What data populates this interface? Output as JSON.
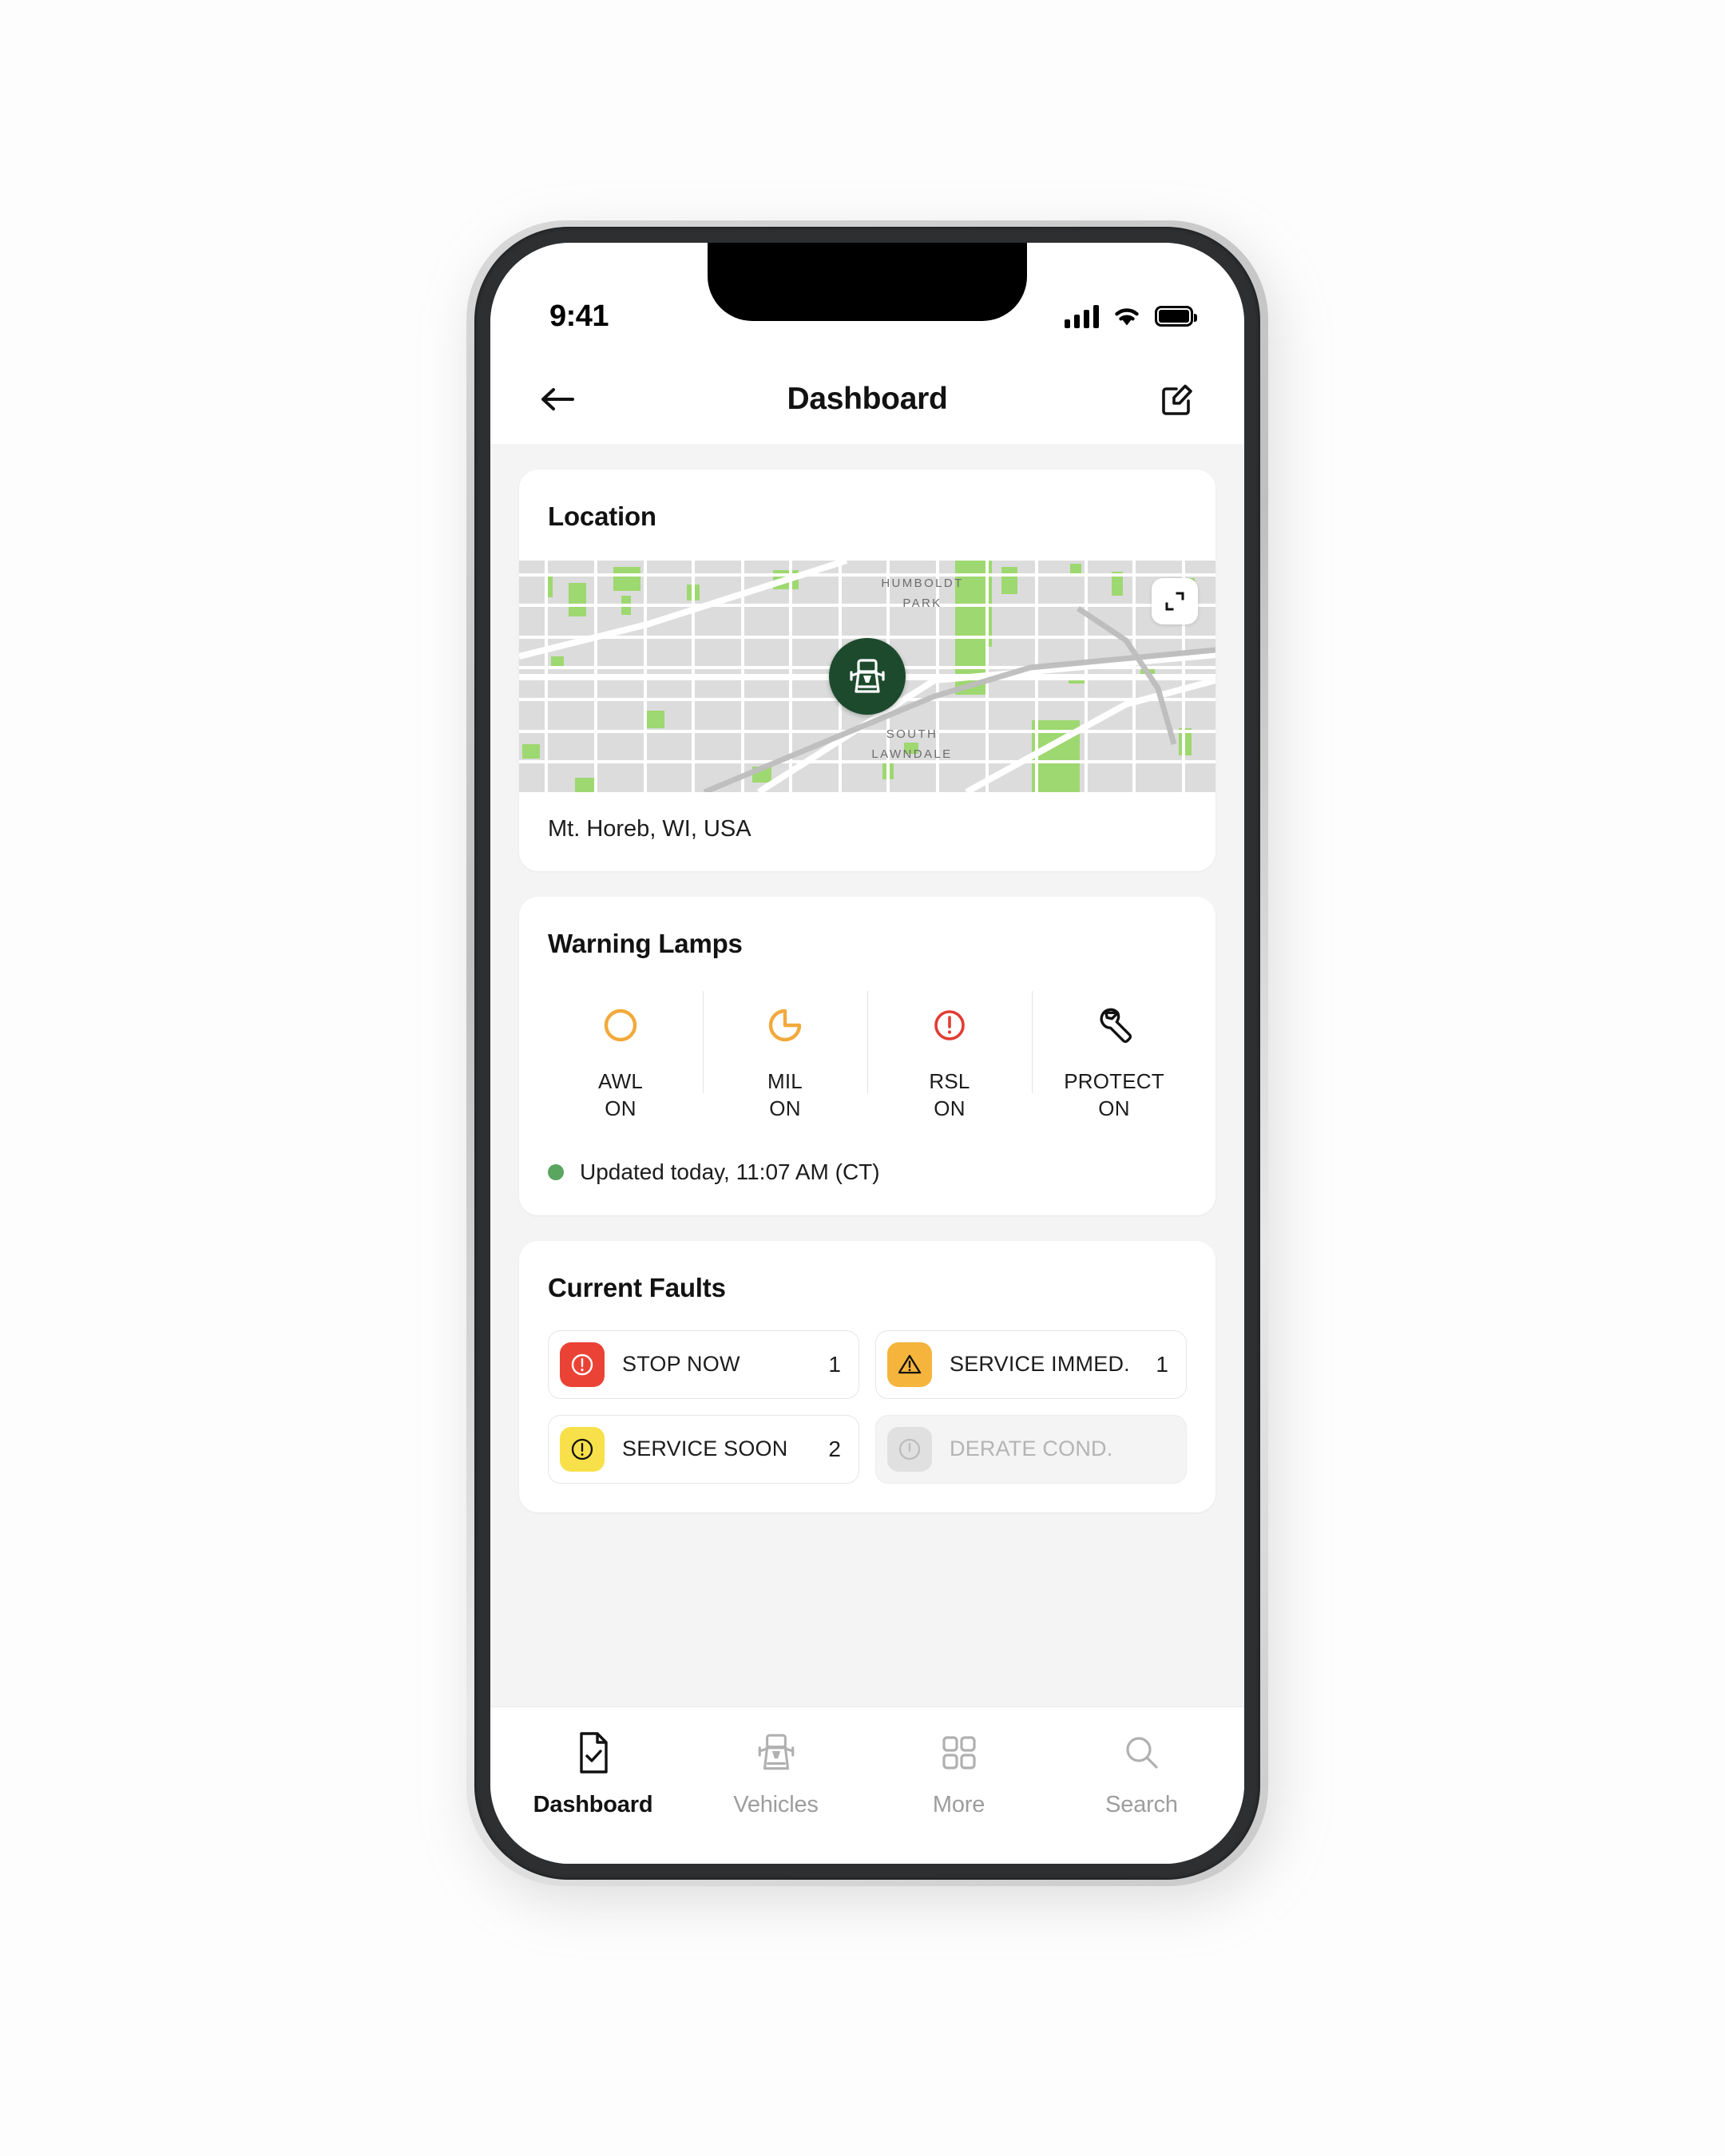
{
  "status_bar": {
    "time": "9:41",
    "signal_icon": "cellular-signal-icon",
    "wifi_icon": "wifi-icon",
    "battery_icon": "battery-full-icon"
  },
  "nav": {
    "back_icon": "back-arrow-icon",
    "title": "Dashboard",
    "edit_icon": "edit-pencil-icon"
  },
  "location_card": {
    "title": "Location",
    "expand_icon": "expand-map-icon",
    "marker_icon": "truck-front-icon",
    "map_labels": [
      {
        "line1": "HUMBOLDT",
        "line2": "PARK"
      },
      {
        "line1": "SOUTH",
        "line2": "LAWNDALE"
      }
    ],
    "caption": "Mt. Horeb, WI, USA"
  },
  "warning_lamps_card": {
    "title": "Warning Lamps",
    "lamps": [
      {
        "icon": "amber-warning-circle-icon",
        "name": "AWL",
        "state": "ON",
        "color": "#F2A93B"
      },
      {
        "icon": "engine-malfunction-icon",
        "name": "MIL",
        "state": "ON",
        "color": "#F2A93B"
      },
      {
        "icon": "red-stop-lamp-icon",
        "name": "RSL",
        "state": "ON",
        "color": "#E23B33"
      },
      {
        "icon": "wrench-icon",
        "name": "PROTECT",
        "state": "ON",
        "color": "#111111"
      }
    ],
    "updated_text": "Updated today, 11:07 AM (CT)",
    "status_dot_color": "#5AA55F"
  },
  "current_faults_card": {
    "title": "Current Faults",
    "faults": [
      {
        "icon": "stop-now-icon",
        "label": "STOP NOW",
        "count": "1",
        "color": "#EA4335",
        "muted": false
      },
      {
        "icon": "service-immediately-icon",
        "label": "SERVICE IMMED.",
        "count": "1",
        "color": "#F5B43C",
        "muted": false
      },
      {
        "icon": "service-soon-icon",
        "label": "SERVICE SOON",
        "count": "2",
        "color": "#F7E04A",
        "muted": false
      },
      {
        "icon": "derate-condition-icon",
        "label": "DERATE COND.",
        "count": "",
        "color": "#E0E0E0",
        "muted": true
      }
    ]
  },
  "tab_bar": {
    "tabs": [
      {
        "icon": "document-check-icon",
        "label": "Dashboard",
        "active": true
      },
      {
        "icon": "truck-front-icon",
        "label": "Vehicles",
        "active": false
      },
      {
        "icon": "grid-squares-icon",
        "label": "More",
        "active": false
      },
      {
        "icon": "search-icon",
        "label": "Search",
        "active": false
      }
    ]
  },
  "colors": {
    "page_background": "#F4F4F4",
    "card_background": "#FFFFFF",
    "marker_green": "#1D4A2D",
    "map_land": "#DCDCDC",
    "map_road": "#FFFFFF",
    "map_park": "#9ED870"
  }
}
